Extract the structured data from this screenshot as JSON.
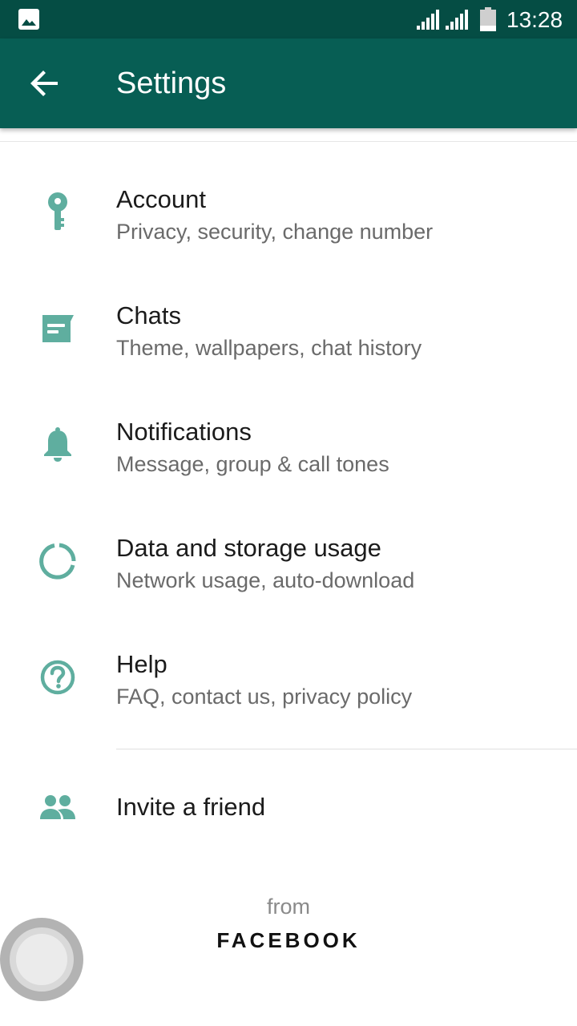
{
  "status_bar": {
    "time": "13:28",
    "icons": [
      "gallery-icon",
      "signal-icon",
      "signal-icon",
      "battery-icon"
    ]
  },
  "app_bar": {
    "title": "Settings",
    "back_icon": "arrow-left-icon"
  },
  "settings": [
    {
      "title": "Account",
      "subtitle": "Privacy, security, change number",
      "icon": "key-icon"
    },
    {
      "title": "Chats",
      "subtitle": "Theme, wallpapers, chat history",
      "icon": "chat-icon"
    },
    {
      "title": "Notifications",
      "subtitle": "Message, group & call tones",
      "icon": "bell-icon"
    },
    {
      "title": "Data and storage usage",
      "subtitle": "Network usage, auto-download",
      "icon": "data-usage-icon"
    },
    {
      "title": "Help",
      "subtitle": "FAQ, contact us, privacy policy",
      "icon": "help-icon"
    }
  ],
  "invite": {
    "title": "Invite a friend",
    "icon": "people-icon"
  },
  "footer": {
    "from": "from",
    "brand": "FACEBOOK"
  },
  "colors": {
    "status_bar": "#054d44",
    "app_bar": "#075e54",
    "icon_accent": "#5fae9f"
  }
}
